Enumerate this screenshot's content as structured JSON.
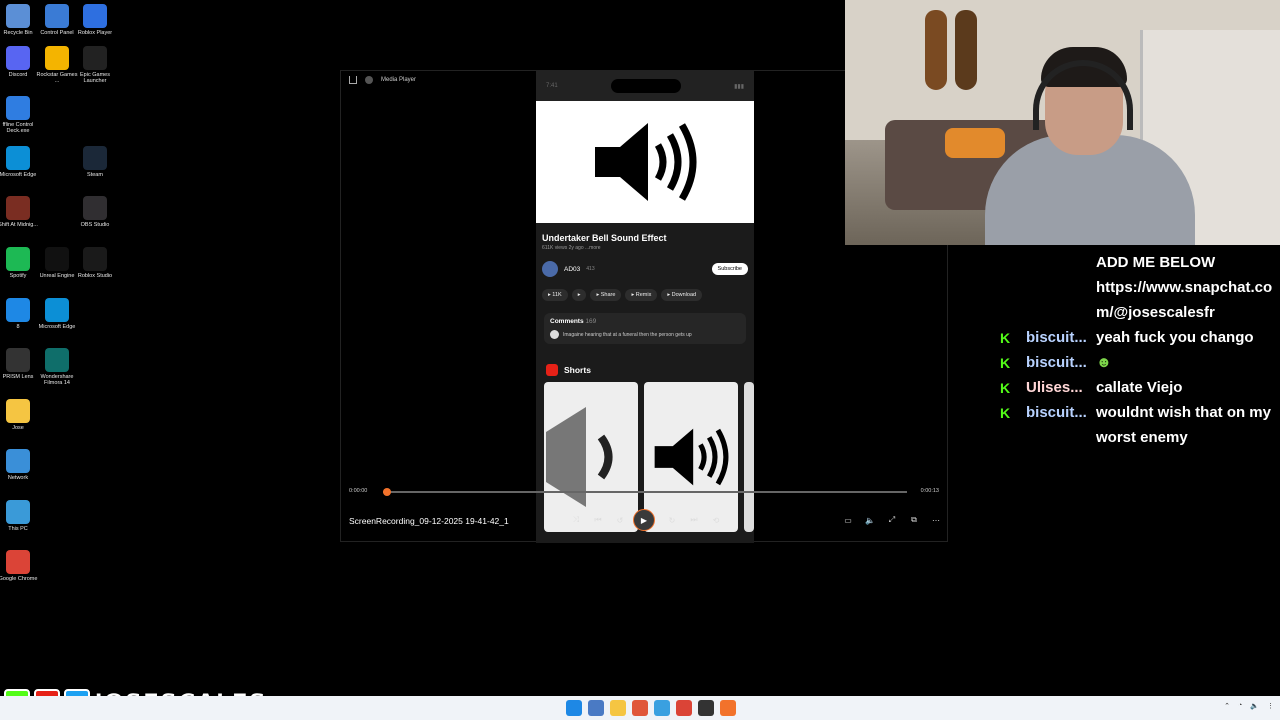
{
  "desktop": {
    "icons": [
      {
        "label": "Recycle Bin",
        "icon": "recycle-bin-icon",
        "color": "#5b8fd6"
      },
      {
        "label": "Control Panel",
        "icon": "control-panel-icon",
        "color": "#3a7bd5"
      },
      {
        "label": "Roblox Player",
        "icon": "roblox-icon",
        "color": "#2e6fe0"
      },
      {
        "label": "Discord",
        "icon": "discord-icon",
        "color": "#5865f2"
      },
      {
        "label": "Rockstar Games ...",
        "icon": "rockstar-icon",
        "color": "#f4b400"
      },
      {
        "label": "Epic Games Launcher",
        "icon": "epic-games-icon",
        "color": "#222222"
      },
      {
        "label": "ffline Control Deck.exe",
        "icon": "control-deck-icon",
        "color": "#2f7de1"
      },
      {
        "label": "Microsoft Edge",
        "icon": "edge-icon",
        "color": "#0c8fd6"
      },
      {
        "label": "Steam",
        "icon": "steam-icon",
        "color": "#1b2838"
      },
      {
        "label": "Shift At Midnig...",
        "icon": "game-icon",
        "color": "#7a2d22"
      },
      {
        "label": "OBS Studio",
        "icon": "obs-icon",
        "color": "#302e31"
      },
      {
        "label": "Spotify",
        "icon": "spotify-icon",
        "color": "#1db954"
      },
      {
        "label": "Unreal Engine",
        "icon": "unreal-icon",
        "color": "#111111"
      },
      {
        "label": "Roblox Studio",
        "icon": "roblox-studio-icon",
        "color": "#1a1a1a"
      },
      {
        "label": "8",
        "icon": "file-icon",
        "color": "#1e88e5"
      },
      {
        "label": "Microsoft Edge",
        "icon": "edge-icon",
        "color": "#0c8fd6"
      },
      {
        "label": "PRISM Lens",
        "icon": "prism-icon",
        "color": "#333333"
      },
      {
        "label": "Wondershare Filmora 14",
        "icon": "filmora-icon",
        "color": "#0f6e6a"
      },
      {
        "label": "Jose",
        "icon": "folder-icon",
        "color": "#f5c542"
      },
      {
        "label": "Network",
        "icon": "network-icon",
        "color": "#3a8fd8"
      },
      {
        "label": "This PC",
        "icon": "this-pc-icon",
        "color": "#3a9ad8"
      },
      {
        "label": "Google Chrome",
        "icon": "chrome-icon",
        "color": "#db4437"
      }
    ]
  },
  "player": {
    "title": "Media Player",
    "filename": "ScreenRecording_09-12-2025 19-41-42_1",
    "time_current": "0:00:00",
    "time_total": "0:00:13",
    "progress_fraction": 0.0,
    "accent": "#f2722b"
  },
  "phone": {
    "status_time": "7:41",
    "video_title": "Undertaker Bell Sound Effect",
    "video_meta": "611K views  2y ago  ...more",
    "channel_name": "AD03",
    "channel_subs": "413",
    "subscribe": "Subscribe",
    "actions": [
      {
        "label": "11K",
        "icon": "like-icon"
      },
      {
        "label": "",
        "icon": "dislike-icon"
      },
      {
        "label": "Share",
        "icon": "share-icon"
      },
      {
        "label": "Remix",
        "icon": "remix-icon"
      },
      {
        "label": "Download",
        "icon": "download-icon"
      }
    ],
    "comments_label": "Comments",
    "comments_count": "169",
    "comment_preview": "Imagaine hearing that at a funeral then the person gets up",
    "shorts_label": "Shorts"
  },
  "chat": {
    "announcement": [
      "ADD ME BELOW",
      "https://www.snapchat.com/@josescalesfr"
    ],
    "messages": [
      {
        "user": "biscuit...",
        "text": "yeah fuck you chango",
        "user_color": "#b8d2ff"
      },
      {
        "user": "biscuit...",
        "text": "",
        "user_color": "#b8d2ff"
      },
      {
        "user": "Ulises...",
        "text": "callate Viejo",
        "user_color": "#ffd6d6"
      },
      {
        "user": "biscuit...",
        "text": "wouldnt wish that on my worst enemy",
        "user_color": "#b8d2ff"
      }
    ]
  },
  "brand": {
    "name": "JOSESCALES",
    "icons": [
      "kick-icon",
      "youtube-icon",
      "twitter-icon"
    ],
    "kick_color": "#53fc18",
    "youtube_color": "#e62117",
    "twitter_color": "#1da1f2"
  }
}
